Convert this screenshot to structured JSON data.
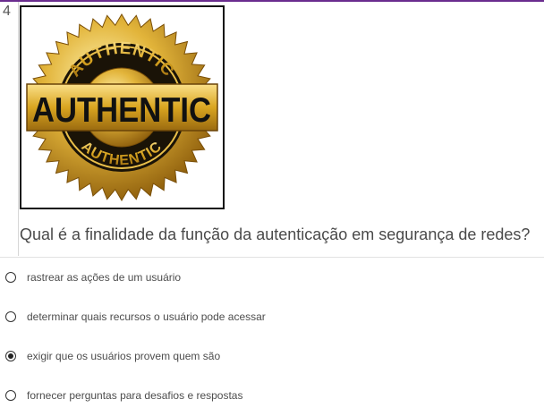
{
  "question": {
    "number": "4",
    "text": "Qual é a finalidade da função da autenticação em segurança de redes?",
    "image": {
      "icon": "authentic-seal-icon",
      "banner_text": "AUTHENTIC",
      "ring_text_top": "AUTHENTIC",
      "ring_text_bottom": "AUTHENTIC"
    }
  },
  "options": [
    {
      "label": "rastrear as ações de um usuário",
      "selected": false
    },
    {
      "label": "determinar quais recursos o usuário pode acessar",
      "selected": false
    },
    {
      "label": "exigir que os usuários provem quem são",
      "selected": true
    },
    {
      "label": "fornecer perguntas para desafios e respostas",
      "selected": false
    }
  ],
  "colors": {
    "accent_bar": "#6a2c8e",
    "gold": "#d9a520",
    "text": "#4a4a4a"
  }
}
